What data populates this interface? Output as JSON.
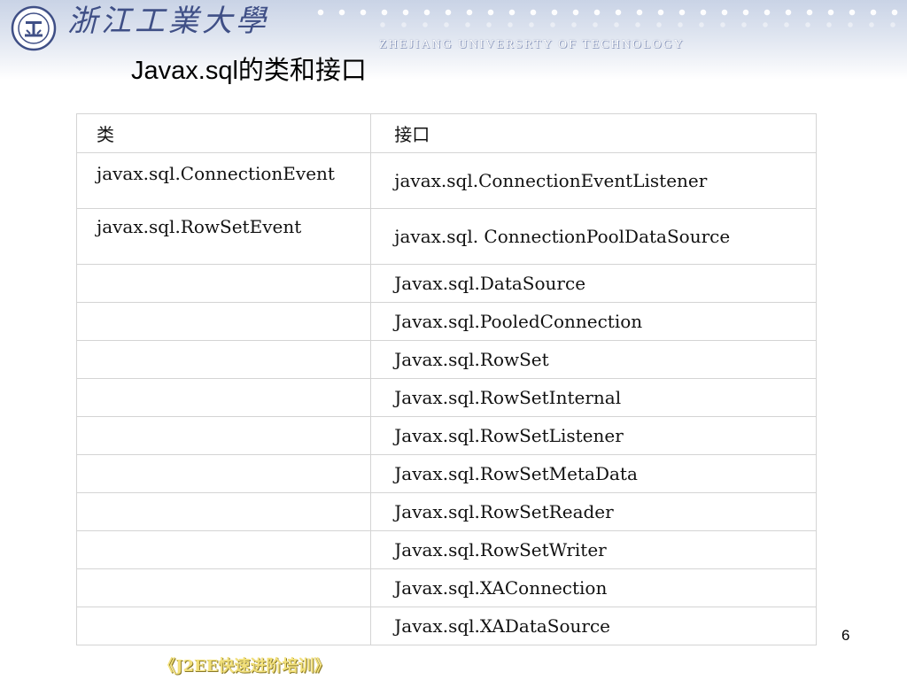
{
  "header": {
    "university_name": "浙江工業大學",
    "university_name_en": "ZHEJIANG UNIVERSRTY OF TECHNOLOGY",
    "logo_icon": "university-seal-icon",
    "band_color": "#c9d3e6",
    "text_color": "#3f4f86"
  },
  "slide": {
    "title": "Javax.sql的类和接口",
    "page_number": "6",
    "footer": "《J2EE快速进阶培训》"
  },
  "table": {
    "headers": [
      "类",
      "接口"
    ],
    "rows": [
      [
        "javax.sql.ConnectionEvent",
        "javax.sql.ConnectionEventListener"
      ],
      [
        "javax.sql.RowSetEvent",
        "javax.sql. ConnectionPoolDataSource"
      ],
      [
        "",
        "Javax.sql.DataSource"
      ],
      [
        "",
        "Javax.sql.PooledConnection"
      ],
      [
        "",
        "Javax.sql.RowSet"
      ],
      [
        "",
        "Javax.sql.RowSetInternal"
      ],
      [
        "",
        "Javax.sql.RowSetListener"
      ],
      [
        "",
        "Javax.sql.RowSetMetaData"
      ],
      [
        "",
        "Javax.sql.RowSetReader"
      ],
      [
        "",
        "Javax.sql.RowSetWriter"
      ],
      [
        "",
        "Javax.sql.XAConnection"
      ],
      [
        "",
        "Javax.sql.XADataSource"
      ]
    ]
  }
}
